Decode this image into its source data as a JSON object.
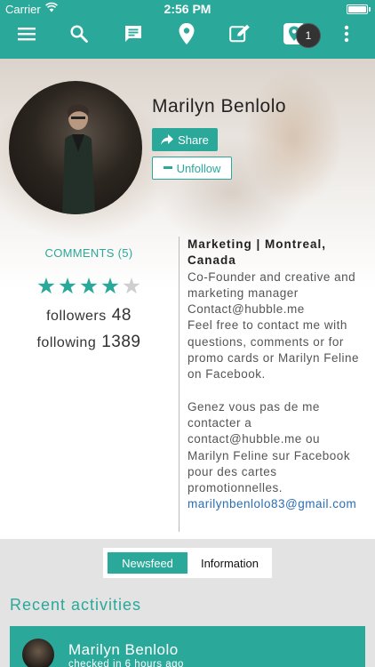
{
  "status_bar": {
    "carrier": "Carrier",
    "time": "2:56 PM"
  },
  "toolbar": {
    "icons": [
      "menu-icon",
      "search-icon",
      "chat-icon",
      "location-pin-icon",
      "edit-icon",
      "map-pin-icon",
      "more-vert-icon"
    ],
    "notification_count": "1"
  },
  "profile": {
    "name": "Marilyn Benlolo",
    "share_label": "Share",
    "unfollow_label": "Unfollow",
    "comments_label": "COMMENTS (5)",
    "rating": 4,
    "rating_max": 5,
    "followers_label": "followers",
    "followers_count": "48",
    "following_label": "following",
    "following_count": "1389"
  },
  "about": {
    "headline": "Marketing | Montreal, Canada",
    "lines": [
      "Co-Founder and creative and marketing manager",
      "Contact@hubble.me",
      "Feel free to contact me with questions, comments or for promo cards or Marilyn Feline on Facebook.",
      "",
      "Genez vous pas de me contacter a contact@hubble.me ou Marilyn Feline sur Facebook pour des cartes promotionnelles."
    ],
    "email": "marilynbenlolo83@gmail.com"
  },
  "tabs": {
    "newsfeed": "Newsfeed",
    "information": "Information"
  },
  "recent": {
    "title": "Recent activities",
    "items": [
      {
        "name": "Marilyn Benlolo",
        "time": "checked in 6 hours ago"
      }
    ]
  },
  "colors": {
    "accent": "#2aa89a",
    "link": "#2a6db5",
    "star_empty": "#cfcfcf"
  }
}
